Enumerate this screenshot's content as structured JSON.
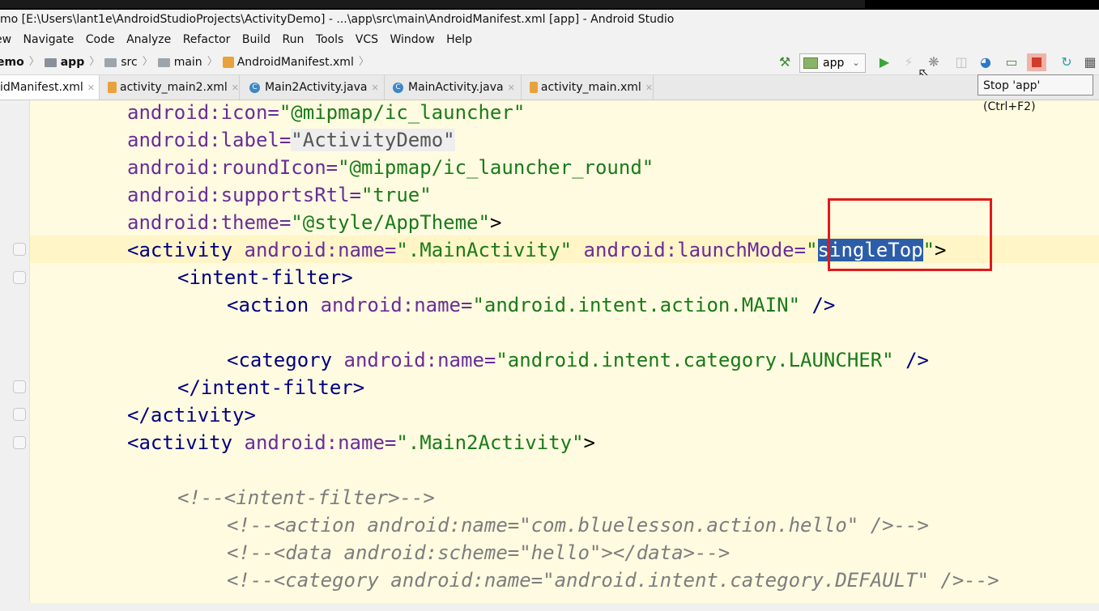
{
  "window": {
    "title": "mo [E:\\Users\\lant1e\\AndroidStudioProjects\\ActivityDemo] - ...\\app\\src\\main\\AndroidManifest.xml [app] - Android Studio"
  },
  "menu": [
    "ew",
    "Navigate",
    "Code",
    "Analyze",
    "Refactor",
    "Build",
    "Run",
    "Tools",
    "VCS",
    "Window",
    "Help"
  ],
  "breadcrumb": {
    "project": "emo",
    "module": "app",
    "src": "src",
    "main": "main",
    "file": "AndroidManifest.xml"
  },
  "toolbar": {
    "run_config": "app",
    "tooltip": "Stop 'app' (Ctrl+F2)"
  },
  "tabs": [
    {
      "label": "idManifest.xml",
      "type": "xml",
      "active": true
    },
    {
      "label": "activity_main2.xml",
      "type": "xml",
      "active": false
    },
    {
      "label": "Main2Activity.java",
      "type": "java",
      "active": false
    },
    {
      "label": "MainActivity.java",
      "type": "java",
      "active": false
    },
    {
      "label": "activity_main.xml",
      "type": "xml",
      "active": false
    }
  ],
  "code": {
    "l1_attr": "android:icon=",
    "l1_val": "\"@mipmap/ic_launcher\"",
    "l2_attr": "android:label=",
    "l2_val": "\"ActivityDemo\"",
    "l3_attr": "android:roundIcon=",
    "l3_val": "\"@mipmap/ic_launcher_round\"",
    "l4_attr": "android:supportsRtl=",
    "l4_val": "\"true\"",
    "l5_attr": "android:theme=",
    "l5_val": "\"@style/AppTheme\"",
    "l5_end": ">",
    "l6_open": "<activity",
    "l6_attr1": "android:name=",
    "l6_val1": "\".MainActivity\"",
    "l6_attr2": "android:launchMode=",
    "l6_q1": "\"",
    "l6_sel": "singleTop",
    "l6_q2": "\"",
    "l6_end": ">",
    "l7": "<intent-filter>",
    "l8_open": "<action",
    "l8_attr": "android:name=",
    "l8_val": "\"android.intent.action.MAIN\"",
    "l8_end": " />",
    "l10_open": "<category",
    "l10_attr": "android:name=",
    "l10_val": "\"android.intent.category.LAUNCHER\"",
    "l10_end": " />",
    "l11": "</intent-filter>",
    "l12": "</activity>",
    "l13_open": "<activity",
    "l13_attr": "android:name=",
    "l13_val": "\".Main2Activity\"",
    "l13_end": ">",
    "c1": "<!--<intent-filter>-->",
    "c2": "<!--<action android:name=\"com.bluelesson.action.hello\" />-->",
    "c3": "<!--<data android:scheme=\"hello\"></data>-->",
    "c4": "<!--<category android:name=\"android.intent.category.DEFAULT\" />-->"
  }
}
